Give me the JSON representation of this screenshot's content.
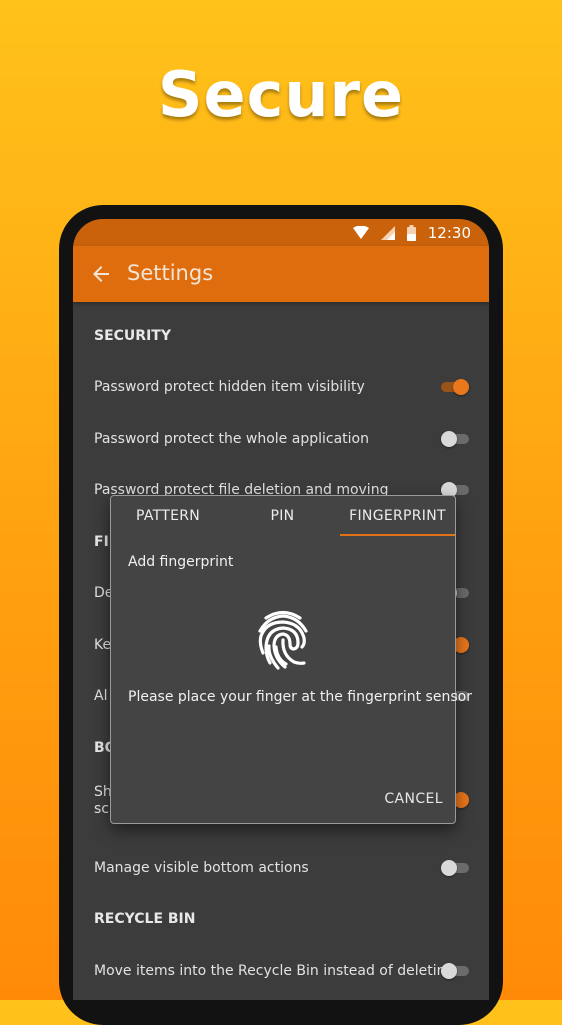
{
  "headline": "Secure",
  "status_bar": {
    "time": "12:30"
  },
  "app_bar": {
    "title": "Settings"
  },
  "sections": {
    "security": {
      "header": "SECURITY",
      "items": [
        {
          "label": "Password protect hidden item visibility",
          "enabled": true
        },
        {
          "label": "Password protect the whole application",
          "enabled": false
        },
        {
          "label": "Password protect file deletion and moving",
          "enabled": false
        }
      ]
    },
    "file_operations": {
      "header_partial": "FI",
      "items": [
        {
          "label_partial": "De",
          "enabled": false
        },
        {
          "label_partial": "Ke",
          "enabled": true
        },
        {
          "label_partial": "Al",
          "enabled": false
        }
      ]
    },
    "bottom_actions": {
      "header_partial": "BO",
      "items": [
        {
          "label_partial_line1": "Sh",
          "label_partial_line2": "sc",
          "enabled": true
        },
        {
          "label": "Manage visible bottom actions",
          "enabled": false
        }
      ]
    },
    "recycle_bin": {
      "header": "RECYCLE BIN",
      "items": [
        {
          "label": "Move items into the Recycle Bin instead of deleting",
          "enabled": false
        }
      ]
    }
  },
  "dialog": {
    "tabs": [
      "PATTERN",
      "PIN",
      "FINGERPRINT"
    ],
    "active_tab": "FINGERPRINT",
    "title": "Add fingerprint",
    "message": "Please place your finger at the fingerprint sensor",
    "cancel_label": "CANCEL"
  },
  "colors": {
    "background_top": "#FFC21A",
    "background_bottom": "#FF8A08",
    "app_bar": "#E06D0D",
    "status_bar": "#C9620A",
    "accent": "#E9771C",
    "screen_background": "#3C3C3C",
    "dialog_background": "#444444"
  }
}
